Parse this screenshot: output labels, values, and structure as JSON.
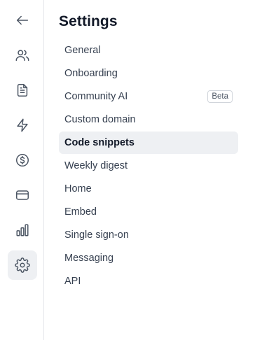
{
  "rail": {
    "items": [
      {
        "icon": "arrow-left-icon",
        "active": false
      },
      {
        "icon": "users-icon",
        "active": false
      },
      {
        "icon": "document-icon",
        "active": false
      },
      {
        "icon": "lightning-icon",
        "active": false
      },
      {
        "icon": "dollar-icon",
        "active": false
      },
      {
        "icon": "credit-card-icon",
        "active": false
      },
      {
        "icon": "bar-chart-icon",
        "active": false
      },
      {
        "icon": "gear-icon",
        "active": true
      }
    ]
  },
  "settings": {
    "title": "Settings",
    "items": [
      {
        "label": "General"
      },
      {
        "label": "Onboarding"
      },
      {
        "label": "Community AI",
        "badge": "Beta"
      },
      {
        "label": "Custom domain"
      },
      {
        "label": "Code snippets",
        "active": true
      },
      {
        "label": "Weekly digest"
      },
      {
        "label": "Home"
      },
      {
        "label": "Embed"
      },
      {
        "label": "Single sign-on"
      },
      {
        "label": "Messaging"
      },
      {
        "label": "API"
      }
    ]
  },
  "colors": {
    "active_bg": "#eef0f3",
    "text": "#374151",
    "border": "#e5e7eb"
  }
}
